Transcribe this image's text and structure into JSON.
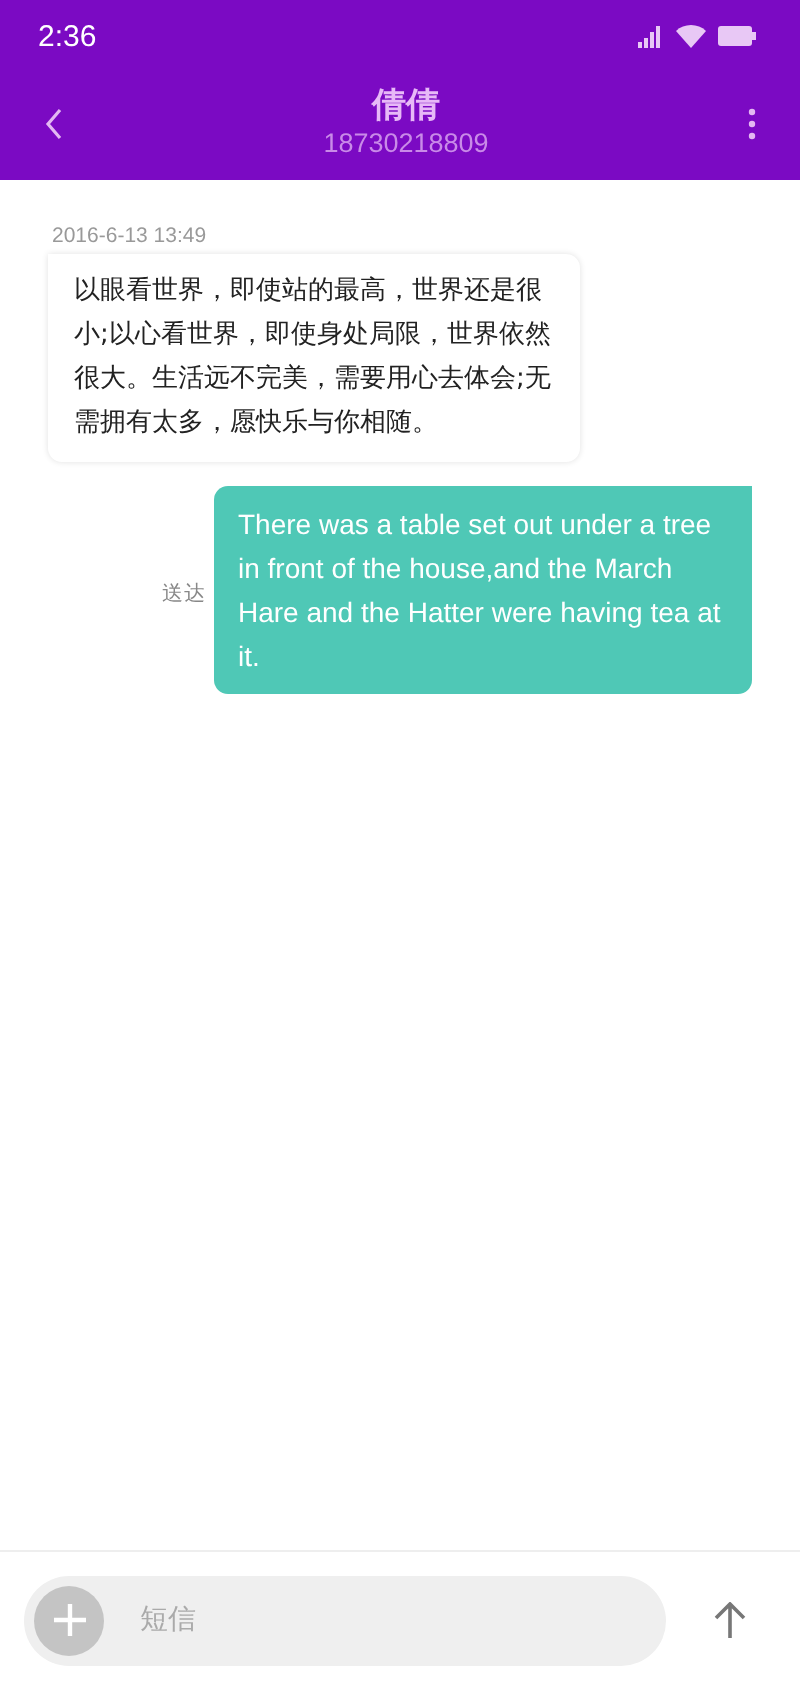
{
  "status_bar": {
    "time": "2:36"
  },
  "header": {
    "title": "倩倩",
    "subtitle": "18730218809"
  },
  "messages": [
    {
      "kind": "received",
      "timestamp": "2016-6-13 13:49",
      "text": "以眼看世界，即使站的最高，世界还是很小;以心看世界，即使身处局限，世界依然很大。生活远不完美，需要用心去体会;无需拥有太多，愿快乐与你相随。"
    },
    {
      "kind": "sent",
      "status": "送达",
      "text": "There was a table set out under a tree in front of the house,and the March Hare and the Hatter were having tea at it."
    }
  ],
  "composer": {
    "placeholder": "短信"
  }
}
